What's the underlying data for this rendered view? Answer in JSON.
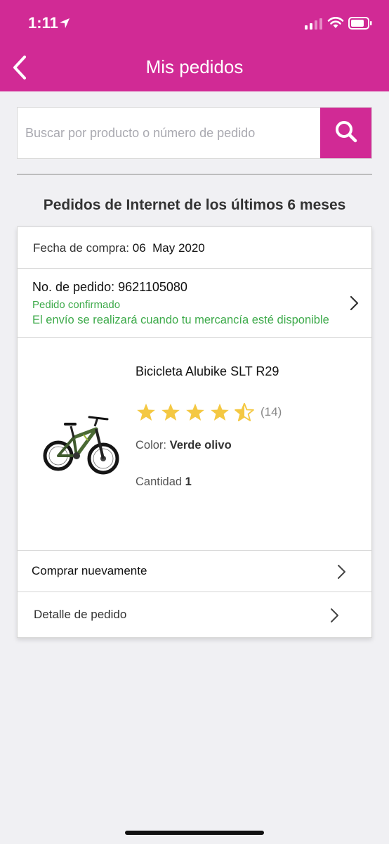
{
  "status_bar": {
    "time": "1:11",
    "icons": [
      "location-arrow-icon",
      "cellular-signal-icon",
      "wifi-icon",
      "battery-icon"
    ]
  },
  "header": {
    "title": "Mis pedidos",
    "back_icon": "chevron-left-icon",
    "background_color": "#d12a95"
  },
  "search": {
    "placeholder": "Buscar por producto o número de pedido",
    "value": "",
    "button_icon": "search-icon"
  },
  "section_title": "Pedidos de Internet de los últimos 6 meses",
  "order": {
    "purchase_date_label": "Fecha de compra:",
    "purchase_date_value": "06  May 2020",
    "order_number_label": "No. de pedido:",
    "order_number_value": "9621105080",
    "status": "Pedido confirmado",
    "shipping_note": "El envío se realizará cuando tu mercancía esté disponible",
    "status_color": "#3daa4a",
    "product": {
      "name": "Bicicleta Alubike SLT R29",
      "rating": 4.5,
      "rating_max": 5,
      "review_count": "(14)",
      "color_label": "Color:",
      "color_value": "Verde olivo",
      "quantity_label": "Cantidad",
      "quantity_value": "1",
      "image_icon": "bicycle-image"
    },
    "actions": {
      "buy_again": "Comprar nuevamente",
      "order_detail": "Detalle de pedido"
    }
  }
}
